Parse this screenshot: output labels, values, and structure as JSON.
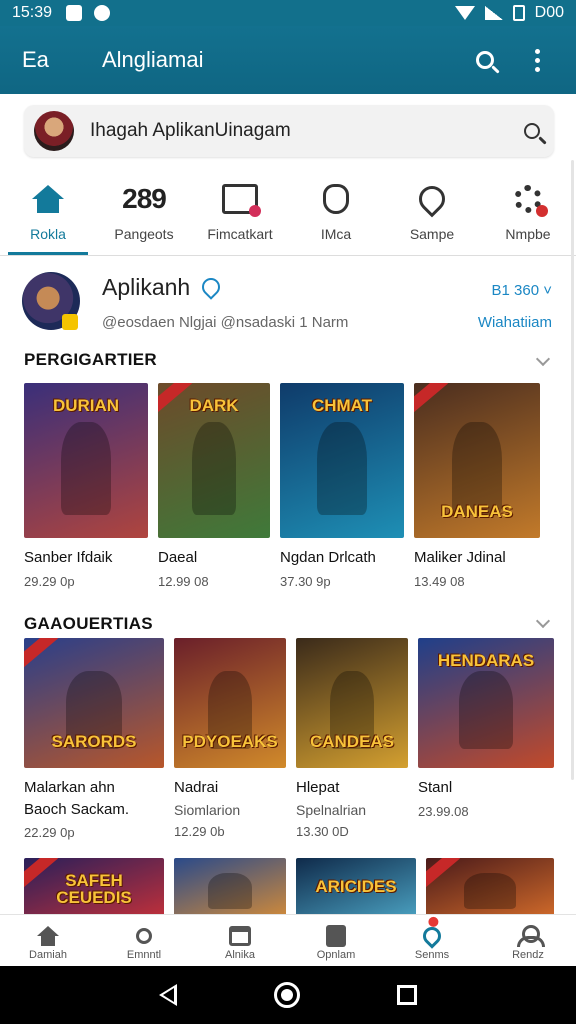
{
  "status_bar": {
    "time": "15:39",
    "battery_text": "D00"
  },
  "app_bar": {
    "left_label": "Ea",
    "title": "Alngliamai"
  },
  "search": {
    "text": "Ihagah AplikanUinagam"
  },
  "tabs": [
    {
      "label": "Rokla",
      "icon": "home-icon",
      "active": true
    },
    {
      "label": "Pangeots",
      "icon_text": "289"
    },
    {
      "label": "Fimcatkart",
      "icon": "frame-icon"
    },
    {
      "label": "IMca",
      "icon": "shield-icon"
    },
    {
      "label": "Sampe",
      "icon": "heart-icon"
    },
    {
      "label": "Nmpbe",
      "icon": "gear-icon"
    }
  ],
  "profile": {
    "name": "Aplikanh",
    "handle": "@eosdaen Nlgjai @nsadaski 1 Narm",
    "count": "B1 360 ˅",
    "link": "Wiahatiiam"
  },
  "sections": [
    {
      "title": "PERGIGARTIER",
      "cards": [
        {
          "title": "Sanber Ifdaik",
          "price": "29.29 0p",
          "art_text": "DURIAN",
          "colors": [
            "#3a2f7a",
            "#b0453e"
          ]
        },
        {
          "title": "Daeal",
          "price": "12.99 08",
          "art_text": "DARK",
          "colors": [
            "#6d4a2a",
            "#3f7a3a"
          ]
        },
        {
          "title": "Ngdan Drlcath",
          "price": "37.30 9p",
          "art_text": "CHMAT",
          "colors": [
            "#0f3b6a",
            "#1e8fb5"
          ]
        },
        {
          "title": "Maliker Jdinal",
          "price": "13.49 08",
          "art_text": "DANEAS",
          "colors": [
            "#4a2d1f",
            "#c27a2a"
          ]
        }
      ]
    },
    {
      "title": "GAAOUERTIAS",
      "cards": [
        {
          "title": "Malarkan ahn",
          "sub": "Baoch Sackam.",
          "price": "22.29 0p",
          "art_text": "SARORDS",
          "colors": [
            "#2a3f8a",
            "#b8572a"
          ]
        },
        {
          "title": "Nadrai",
          "sub": "Siomlarion",
          "price": "12.29 0b",
          "art_text": "PDYOEAKS",
          "colors": [
            "#6a1f2a",
            "#d18a2a"
          ]
        },
        {
          "title": "Hlepat",
          "sub": "Spelnalrian",
          "price": "13.30 0D",
          "art_text": "CANDEAS",
          "colors": [
            "#3a2a1a",
            "#d4a030"
          ]
        },
        {
          "title": "Stanl",
          "price": "23.99.08",
          "art_text": "HENDARAS",
          "colors": [
            "#1f3f8a",
            "#c24a2a"
          ]
        }
      ]
    },
    {
      "cards": [
        {
          "art_text": "SAFEH CEUEDIS",
          "colors": [
            "#2a1f5a",
            "#c0303a"
          ]
        },
        {
          "art_text": "",
          "colors": [
            "#2a4a8a",
            "#d08a3a"
          ]
        },
        {
          "art_text": "ARICIDES",
          "colors": [
            "#0f2a4a",
            "#4aa0c0"
          ]
        },
        {
          "art_text": "",
          "colors": [
            "#4a1a1a",
            "#d06a2a"
          ]
        }
      ]
    }
  ],
  "bottom_nav": [
    {
      "label": "Damiah",
      "icon": "home-icon"
    },
    {
      "label": "Emnntl",
      "icon": "search-icon"
    },
    {
      "label": "Alnika",
      "icon": "store-icon"
    },
    {
      "label": "Opnlam",
      "icon": "book-icon"
    },
    {
      "label": "Senms",
      "icon": "pin-icon"
    },
    {
      "label": "Rendz",
      "icon": "person-icon"
    }
  ]
}
